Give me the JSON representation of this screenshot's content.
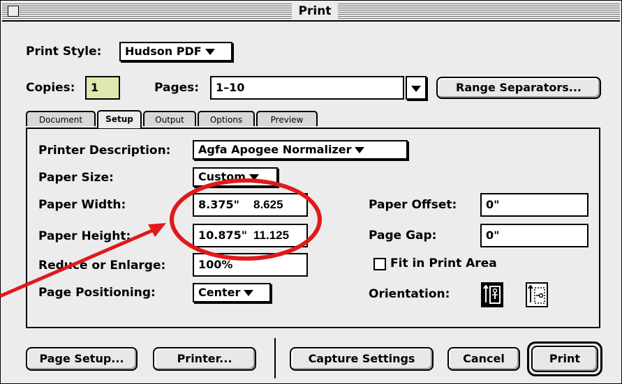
{
  "window": {
    "title": "Print"
  },
  "print_style": {
    "label": "Print Style:",
    "value": "Hudson PDF"
  },
  "copies": {
    "label": "Copies:",
    "value": "1"
  },
  "pages": {
    "label": "Pages:",
    "value": "1–10"
  },
  "range_button": "Range Separators...",
  "tabs": [
    {
      "label": "Document",
      "active": false
    },
    {
      "label": "Setup",
      "active": true
    },
    {
      "label": "Output",
      "active": false
    },
    {
      "label": "Options",
      "active": false
    },
    {
      "label": "Preview",
      "active": false
    }
  ],
  "setup": {
    "printer_description": {
      "label": "Printer Description:",
      "value": "Agfa Apogee Normalizer"
    },
    "paper_size": {
      "label": "Paper Size:",
      "value": "Custom"
    },
    "paper_width": {
      "label": "Paper Width:",
      "value": "8.375\"",
      "annotation": "8.625"
    },
    "paper_height": {
      "label": "Paper Height:",
      "value": "10.875\"",
      "annotation": "11.125"
    },
    "reduce_enlarge": {
      "label": "Reduce or Enlarge:",
      "value": "100%"
    },
    "page_positioning": {
      "label": "Page Positioning:",
      "value": "Center"
    },
    "paper_offset": {
      "label": "Paper Offset:",
      "value": "0\""
    },
    "page_gap": {
      "label": "Page Gap:",
      "value": "0\""
    },
    "fit_in_print_area": {
      "label": "Fit in Print Area",
      "checked": false
    },
    "orientation": {
      "label": "Orientation:",
      "options": [
        "portrait-icon",
        "landscape-icon"
      ],
      "selected": "portrait-icon"
    }
  },
  "buttons": {
    "page_setup": "Page Setup...",
    "printer": "Printer...",
    "capture_settings": "Capture Settings",
    "cancel": "Cancel",
    "print": "Print"
  },
  "annotation_color": "#e0191b"
}
